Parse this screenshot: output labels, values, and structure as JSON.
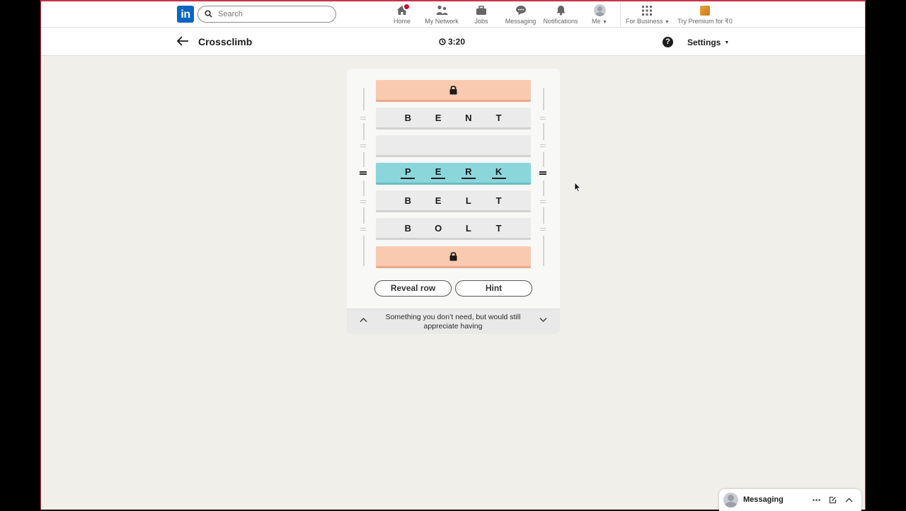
{
  "topnav": {
    "logo": "in",
    "search_placeholder": "Search",
    "items": [
      {
        "label": "Home",
        "icon": "home-icon"
      },
      {
        "label": "My Network",
        "icon": "network-icon"
      },
      {
        "label": "Jobs",
        "icon": "briefcase-icon"
      },
      {
        "label": "Messaging",
        "icon": "chat-icon"
      },
      {
        "label": "Notifications",
        "icon": "bell-icon"
      },
      {
        "label": "Me",
        "icon": "avatar-icon"
      },
      {
        "label": "For Business",
        "icon": "grid-icon"
      },
      {
        "label": "Try Premium for ₹0",
        "icon": "premium-icon"
      }
    ]
  },
  "subheader": {
    "title": "Crossclimb",
    "timer": "3:20",
    "help": "?",
    "settings_label": "Settings"
  },
  "game": {
    "rows": [
      {
        "state": "locked",
        "letters": []
      },
      {
        "state": "filled",
        "letters": [
          "B",
          "E",
          "N",
          "T"
        ]
      },
      {
        "state": "empty",
        "letters": []
      },
      {
        "state": "active",
        "letters": [
          "P",
          "E",
          "R",
          "K"
        ]
      },
      {
        "state": "filled",
        "letters": [
          "B",
          "E",
          "L",
          "T"
        ]
      },
      {
        "state": "filled",
        "letters": [
          "B",
          "O",
          "L",
          "T"
        ]
      },
      {
        "state": "locked",
        "letters": []
      }
    ],
    "reveal_label": "Reveal row",
    "hint_label": "Hint",
    "clue": "Something you don’t need, but would still appreciate having"
  },
  "messaging": {
    "label": "Messaging"
  },
  "colors": {
    "linkedin_blue": "#0a66c2",
    "locked_row": "#f9cab0",
    "active_row": "#8ad6db",
    "plain_row": "#ebebeb",
    "notification_red": "#cb112d"
  }
}
